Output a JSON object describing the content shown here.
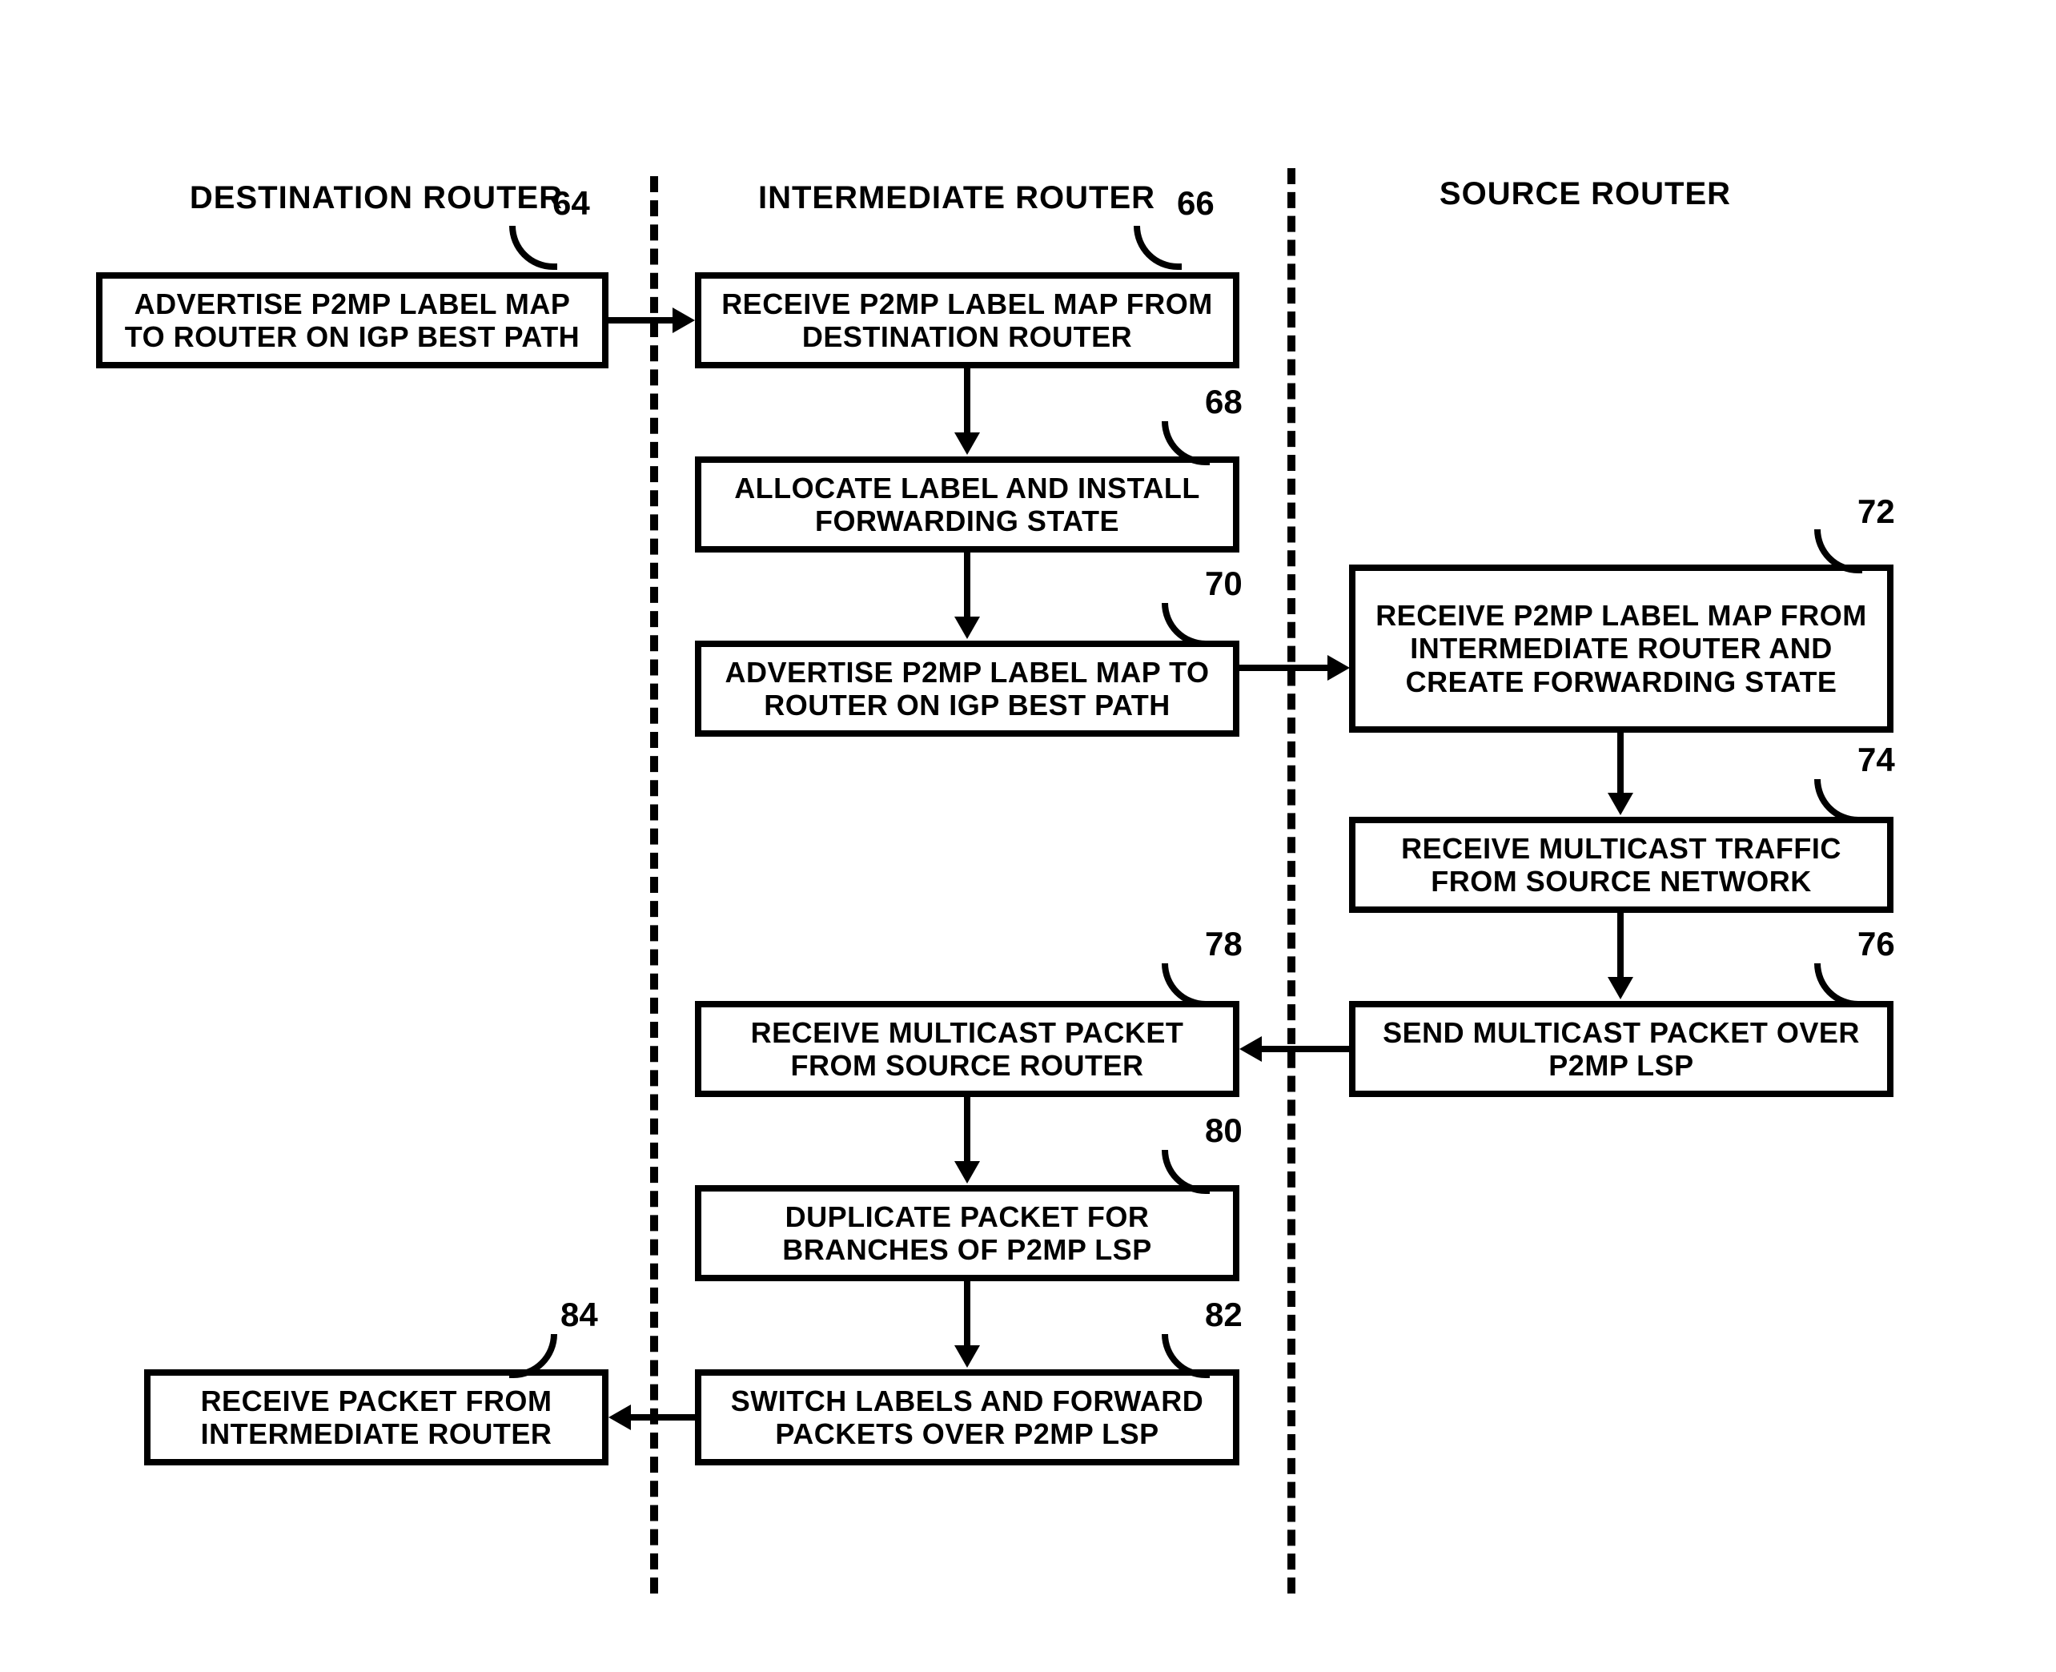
{
  "columns": {
    "destination": "DESTINATION ROUTER",
    "intermediate": "INTERMEDIATE ROUTER",
    "source": "SOURCE ROUTER"
  },
  "boxes": {
    "b64": "ADVERTISE P2MP LABEL MAP TO ROUTER ON IGP BEST PATH",
    "b66": "RECEIVE P2MP LABEL MAP FROM DESTINATION ROUTER",
    "b68": "ALLOCATE LABEL AND INSTALL FORWARDING STATE",
    "b70": "ADVERTISE P2MP LABEL MAP TO ROUTER ON IGP BEST PATH",
    "b72": "RECEIVE P2MP LABEL MAP FROM INTERMEDIATE ROUTER AND CREATE FORWARDING STATE",
    "b74": "RECEIVE MULTICAST TRAFFIC FROM SOURCE NETWORK",
    "b76": "SEND MULTICAST PACKET OVER P2MP LSP",
    "b78": "RECEIVE MULTICAST PACKET FROM SOURCE ROUTER",
    "b80": "DUPLICATE PACKET FOR BRANCHES OF P2MP LSP",
    "b82": "SWITCH LABELS AND FORWARD PACKETS OVER P2MP LSP",
    "b84": "RECEIVE PACKET FROM INTERMEDIATE ROUTER"
  },
  "labels": {
    "n64": "64",
    "n66": "66",
    "n68": "68",
    "n70": "70",
    "n72": "72",
    "n74": "74",
    "n76": "76",
    "n78": "78",
    "n80": "80",
    "n82": "82",
    "n84": "84"
  }
}
